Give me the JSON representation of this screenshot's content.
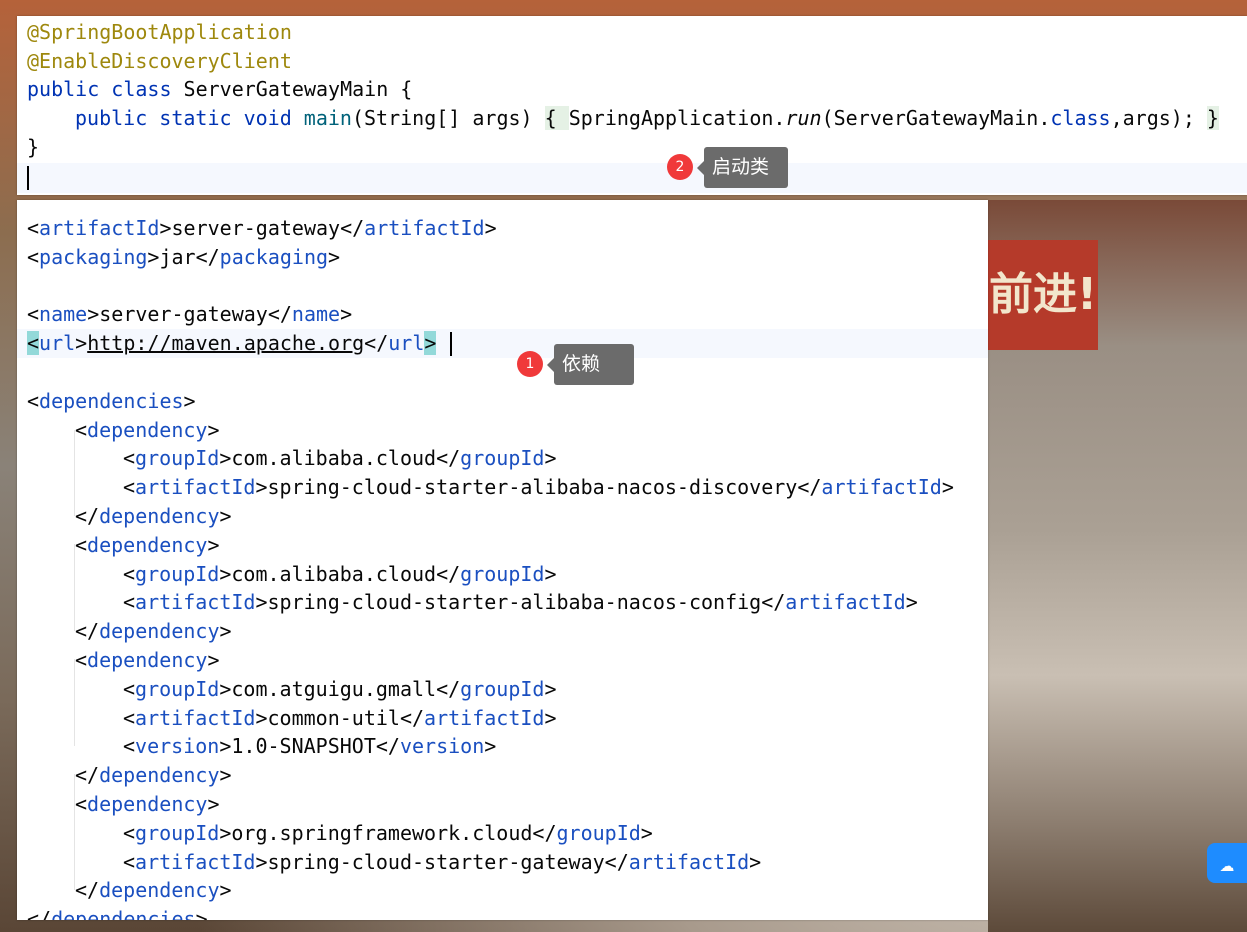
{
  "editor_top": {
    "lines": [
      {
        "indent": 0,
        "tokens": [
          {
            "t": "@SpringBootApplication",
            "c": "ann"
          }
        ]
      },
      {
        "indent": 0,
        "tokens": [
          {
            "t": "@EnableDiscoveryClient",
            "c": "ann"
          }
        ]
      },
      {
        "indent": 0,
        "tokens": [
          {
            "t": "public class ",
            "c": "kw"
          },
          {
            "t": "ServerGatewayMain {",
            "c": ""
          }
        ]
      },
      {
        "indent": 1,
        "tokens": [
          {
            "t": "public static void ",
            "c": "kw"
          },
          {
            "t": "main",
            "c": "fn"
          },
          {
            "t": "(String[] args) ",
            "c": ""
          },
          {
            "t": "{ ",
            "c": "br"
          },
          {
            "t": "SpringApplication.",
            "c": ""
          },
          {
            "t": "run",
            "c": "it"
          },
          {
            "t": "(ServerGatewayMain.",
            "c": ""
          },
          {
            "t": "class",
            "c": "kw"
          },
          {
            "t": ",args); ",
            "c": ""
          },
          {
            "t": "}",
            "c": "br"
          }
        ]
      },
      {
        "indent": 0,
        "tokens": [
          {
            "t": "}",
            "c": ""
          }
        ]
      },
      {
        "indent": 0,
        "tokens": []
      }
    ]
  },
  "editor_pom": {
    "lines": [
      {
        "indent": 0,
        "tokens": [
          {
            "t": "<",
            "c": ""
          },
          {
            "t": "artifactId",
            "c": "tag"
          },
          {
            "t": ">server-gateway</",
            "c": ""
          },
          {
            "t": "artifactId",
            "c": "tag"
          },
          {
            "t": ">",
            "c": ""
          }
        ]
      },
      {
        "indent": 0,
        "tokens": [
          {
            "t": "<",
            "c": ""
          },
          {
            "t": "packaging",
            "c": "tag"
          },
          {
            "t": ">jar</",
            "c": ""
          },
          {
            "t": "packaging",
            "c": "tag"
          },
          {
            "t": ">",
            "c": ""
          }
        ]
      },
      {
        "indent": 0,
        "tokens": []
      },
      {
        "indent": 0,
        "tokens": [
          {
            "t": "<",
            "c": ""
          },
          {
            "t": "name",
            "c": "tag"
          },
          {
            "t": ">server-gateway</",
            "c": ""
          },
          {
            "t": "name",
            "c": "tag"
          },
          {
            "t": ">",
            "c": ""
          }
        ]
      },
      {
        "indent": 0,
        "tokens": [
          {
            "t": "<",
            "c": "hl"
          },
          {
            "t": "url",
            "c": "tag"
          },
          {
            "t": ">",
            "c": ""
          },
          {
            "t": "http://maven.apache.org",
            "c": "ul"
          },
          {
            "t": "</",
            "c": ""
          },
          {
            "t": "url",
            "c": "tag"
          },
          {
            "t": ">",
            "c": "hl"
          }
        ]
      },
      {
        "indent": 0,
        "tokens": []
      },
      {
        "indent": 0,
        "tokens": [
          {
            "t": "<",
            "c": ""
          },
          {
            "t": "dependencies",
            "c": "tag"
          },
          {
            "t": ">",
            "c": ""
          }
        ]
      },
      {
        "indent": 1,
        "tokens": [
          {
            "t": "<",
            "c": ""
          },
          {
            "t": "dependency",
            "c": "tag"
          },
          {
            "t": ">",
            "c": ""
          }
        ]
      },
      {
        "indent": 2,
        "tokens": [
          {
            "t": "<",
            "c": ""
          },
          {
            "t": "groupId",
            "c": "tag"
          },
          {
            "t": ">com.alibaba.cloud</",
            "c": ""
          },
          {
            "t": "groupId",
            "c": "tag"
          },
          {
            "t": ">",
            "c": ""
          }
        ]
      },
      {
        "indent": 2,
        "tokens": [
          {
            "t": "<",
            "c": ""
          },
          {
            "t": "artifactId",
            "c": "tag"
          },
          {
            "t": ">spring-cloud-starter-alibaba-nacos-discovery</",
            "c": ""
          },
          {
            "t": "artifactId",
            "c": "tag"
          },
          {
            "t": ">",
            "c": ""
          }
        ]
      },
      {
        "indent": 1,
        "tokens": [
          {
            "t": "</",
            "c": ""
          },
          {
            "t": "dependency",
            "c": "tag"
          },
          {
            "t": ">",
            "c": ""
          }
        ]
      },
      {
        "indent": 1,
        "tokens": [
          {
            "t": "<",
            "c": ""
          },
          {
            "t": "dependency",
            "c": "tag"
          },
          {
            "t": ">",
            "c": ""
          }
        ]
      },
      {
        "indent": 2,
        "tokens": [
          {
            "t": "<",
            "c": ""
          },
          {
            "t": "groupId",
            "c": "tag"
          },
          {
            "t": ">com.alibaba.cloud</",
            "c": ""
          },
          {
            "t": "groupId",
            "c": "tag"
          },
          {
            "t": ">",
            "c": ""
          }
        ]
      },
      {
        "indent": 2,
        "tokens": [
          {
            "t": "<",
            "c": ""
          },
          {
            "t": "artifactId",
            "c": "tag"
          },
          {
            "t": ">spring-cloud-starter-alibaba-nacos-config</",
            "c": ""
          },
          {
            "t": "artifactId",
            "c": "tag"
          },
          {
            "t": ">",
            "c": ""
          }
        ]
      },
      {
        "indent": 1,
        "tokens": [
          {
            "t": "</",
            "c": ""
          },
          {
            "t": "dependency",
            "c": "tag"
          },
          {
            "t": ">",
            "c": ""
          }
        ]
      },
      {
        "indent": 1,
        "tokens": [
          {
            "t": "<",
            "c": ""
          },
          {
            "t": "dependency",
            "c": "tag"
          },
          {
            "t": ">",
            "c": ""
          }
        ]
      },
      {
        "indent": 2,
        "tokens": [
          {
            "t": "<",
            "c": ""
          },
          {
            "t": "groupId",
            "c": "tag"
          },
          {
            "t": ">com.atguigu.gmall</",
            "c": ""
          },
          {
            "t": "groupId",
            "c": "tag"
          },
          {
            "t": ">",
            "c": ""
          }
        ]
      },
      {
        "indent": 2,
        "tokens": [
          {
            "t": "<",
            "c": ""
          },
          {
            "t": "artifactId",
            "c": "tag"
          },
          {
            "t": ">common-util</",
            "c": ""
          },
          {
            "t": "artifactId",
            "c": "tag"
          },
          {
            "t": ">",
            "c": ""
          }
        ]
      },
      {
        "indent": 2,
        "tokens": [
          {
            "t": "<",
            "c": ""
          },
          {
            "t": "version",
            "c": "tag"
          },
          {
            "t": ">1.0-SNAPSHOT</",
            "c": ""
          },
          {
            "t": "version",
            "c": "tag"
          },
          {
            "t": ">",
            "c": ""
          }
        ]
      },
      {
        "indent": 1,
        "tokens": [
          {
            "t": "</",
            "c": ""
          },
          {
            "t": "dependency",
            "c": "tag"
          },
          {
            "t": ">",
            "c": ""
          }
        ]
      },
      {
        "indent": 1,
        "tokens": [
          {
            "t": "<",
            "c": ""
          },
          {
            "t": "dependency",
            "c": "tag"
          },
          {
            "t": ">",
            "c": ""
          }
        ]
      },
      {
        "indent": 2,
        "tokens": [
          {
            "t": "<",
            "c": ""
          },
          {
            "t": "groupId",
            "c": "tag"
          },
          {
            "t": ">org.springframework.cloud</",
            "c": ""
          },
          {
            "t": "groupId",
            "c": "tag"
          },
          {
            "t": ">",
            "c": ""
          }
        ]
      },
      {
        "indent": 2,
        "tokens": [
          {
            "t": "<",
            "c": ""
          },
          {
            "t": "artifactId",
            "c": "tag"
          },
          {
            "t": ">spring-cloud-starter-gateway</",
            "c": ""
          },
          {
            "t": "artifactId",
            "c": "tag"
          },
          {
            "t": ">",
            "c": ""
          }
        ]
      },
      {
        "indent": 1,
        "tokens": [
          {
            "t": "</",
            "c": ""
          },
          {
            "t": "dependency",
            "c": "tag"
          },
          {
            "t": ">",
            "c": ""
          }
        ]
      },
      {
        "indent": 0,
        "tokens": [
          {
            "t": "</",
            "c": ""
          },
          {
            "t": "dependencies",
            "c": "tag"
          },
          {
            "t": ">",
            "c": ""
          }
        ]
      }
    ]
  },
  "annotations": [
    {
      "number": "1",
      "label": "依赖"
    },
    {
      "number": "2",
      "label": "启动类"
    }
  ],
  "background": {
    "banner_text": "前进!"
  },
  "icons": {
    "floating": "cloud-drive-icon"
  }
}
